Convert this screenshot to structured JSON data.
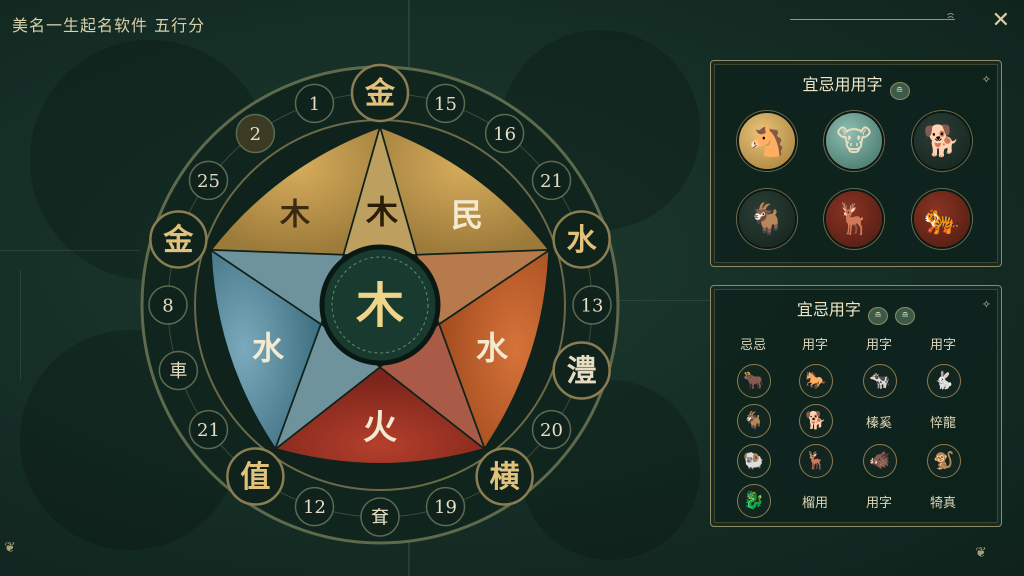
{
  "app": {
    "title": "美名一生起名软件 五行分"
  },
  "window": {
    "close_glyph": "✕",
    "swirl_glyph": "ꩰ"
  },
  "wheel": {
    "outer_nodes": [
      {
        "label": "金",
        "kind": "big"
      },
      {
        "label": "15",
        "kind": "num"
      },
      {
        "label": "16",
        "kind": "num"
      },
      {
        "label": "21",
        "kind": "num"
      },
      {
        "label": "水",
        "kind": "big"
      },
      {
        "label": "13",
        "kind": "num"
      },
      {
        "label": "澧",
        "kind": "big-plain"
      },
      {
        "label": "20",
        "kind": "num"
      },
      {
        "label": "横",
        "kind": "big"
      },
      {
        "label": "19",
        "kind": "num"
      },
      {
        "label": "耷",
        "kind": "num"
      },
      {
        "label": "12",
        "kind": "num"
      },
      {
        "label": "值",
        "kind": "big"
      },
      {
        "label": "21",
        "kind": "num"
      },
      {
        "label": "車",
        "kind": "num"
      },
      {
        "label": "8",
        "kind": "num"
      },
      {
        "label": "金",
        "kind": "big"
      },
      {
        "label": "25",
        "kind": "num"
      },
      {
        "label": "2",
        "kind": "num-active"
      },
      {
        "label": "1",
        "kind": "num"
      }
    ],
    "segments": {
      "top_left": "木",
      "top_center": "木",
      "top_right": "民",
      "left": "水",
      "right": "水",
      "bottom": "火",
      "center": "木"
    },
    "colors": {
      "gold": "#b8924a",
      "gold_light": "#d8ae5e",
      "blue": "#5e8fa2",
      "orange": "#c45e2a",
      "red": "#9b3324",
      "hub": "#183a2f",
      "rim": "#0f221c",
      "accent_text": "#e2c27a"
    }
  },
  "panel1": {
    "title": "宜忌用用字",
    "badge": "≘",
    "sparkle": "✧",
    "animals": [
      {
        "icon": "horse-icon",
        "glyph": "🐴",
        "style": "gold"
      },
      {
        "icon": "ox-icon",
        "glyph": "🐮",
        "style": "teal"
      },
      {
        "icon": "dog-icon",
        "glyph": "🐕",
        "style": "dark"
      },
      {
        "icon": "goat-icon",
        "glyph": "🐐",
        "style": "dark"
      },
      {
        "icon": "deer-icon",
        "glyph": "🦌",
        "style": "red"
      },
      {
        "icon": "tiger-icon",
        "glyph": "🐅",
        "style": "red"
      }
    ]
  },
  "panel2": {
    "title": "宜忌用字",
    "badges": [
      "≘",
      "≘"
    ],
    "sparkle": "✧",
    "headers": [
      "忌忌",
      "用字",
      "用字",
      "用字"
    ],
    "rows": [
      [
        {
          "icon": "ox-icon",
          "glyph": "🐂"
        },
        {
          "icon": "horse-icon",
          "glyph": "🐎"
        },
        {
          "icon": "cow-icon",
          "glyph": "🐄"
        },
        {
          "icon": "rabbit-icon",
          "glyph": "🐇"
        }
      ],
      [
        {
          "icon": "goat-icon",
          "glyph": "🐐"
        },
        {
          "icon": "dog-icon",
          "glyph": "🐕"
        },
        {
          "text": "榛奚"
        },
        {
          "text": "悴龍"
        }
      ],
      [
        {
          "icon": "ram-icon",
          "glyph": "🐏"
        },
        {
          "icon": "deer-icon",
          "glyph": "🦌"
        },
        {
          "icon": "boar-icon",
          "glyph": "🐗"
        },
        {
          "icon": "monkey-icon",
          "glyph": "🐒"
        }
      ],
      [
        {
          "icon": "dragon-icon",
          "glyph": "🐉"
        },
        {
          "text": "榴用"
        },
        {
          "text": "用字"
        },
        {
          "text": "犄真"
        }
      ]
    ]
  }
}
